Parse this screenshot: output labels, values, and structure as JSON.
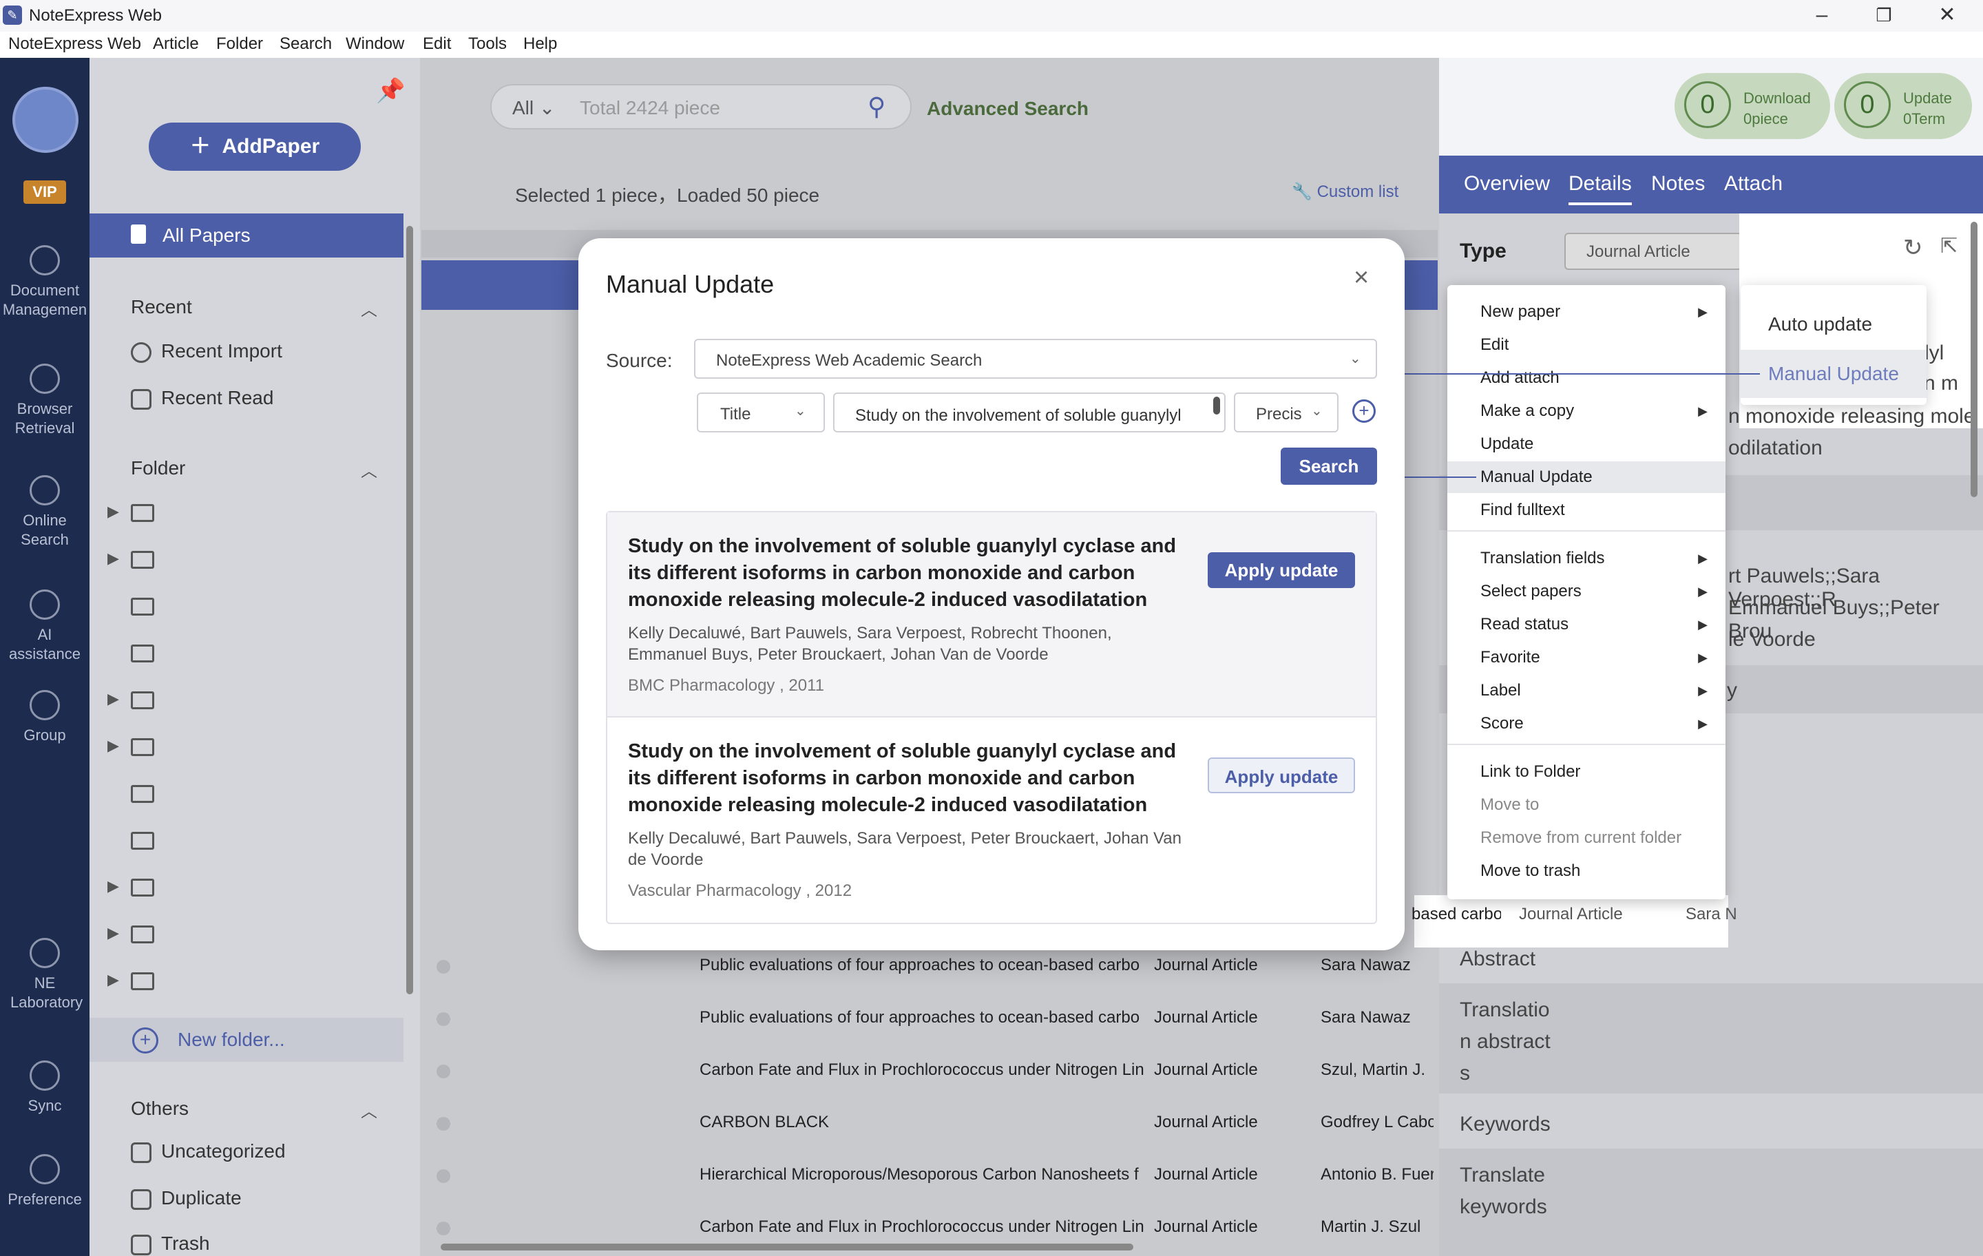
{
  "app": {
    "title": "NoteExpress Web"
  },
  "menubar": [
    "NoteExpress Web",
    "Article",
    "Folder",
    "Search",
    "Window",
    "Edit",
    "Tools",
    "Help"
  ],
  "rail": {
    "vip": "VIP",
    "items": [
      "Document Managemen",
      "Browser Retrieval",
      "Online Search",
      "AI assistance",
      "Group",
      "NE Laboratory",
      "Sync",
      "Preference"
    ]
  },
  "sidebar": {
    "add_paper": "AddPaper",
    "all_papers": "All Papers",
    "recent_head": "Recent",
    "recent_import": "Recent Import",
    "recent_read": "Recent Read",
    "folder_head": "Folder",
    "new_folder": "New folder...",
    "others_head": "Others",
    "uncategorized": "Uncategorized",
    "duplicate": "Duplicate",
    "trash": "Trash"
  },
  "search": {
    "scope": "All",
    "placeholder": "Total 2424 piece",
    "advanced": "Advanced Search"
  },
  "list": {
    "selection_info": "Selected 1 piece，Loaded 50 piece",
    "custom_list": "Custom list",
    "rows": [
      {
        "title": "Public evaluations of four approaches to ocean-based carbo",
        "type": "Journal Article",
        "author": "Sara Nawaz"
      },
      {
        "title": "Public evaluations of four approaches to ocean-based carbo",
        "type": "Journal Article",
        "author": "Sara Nawaz"
      },
      {
        "title": "Carbon Fate and Flux in Prochlorococcus under Nitrogen Lin",
        "type": "Journal Article",
        "author": "Szul, Martin J."
      },
      {
        "title": "CARBON BLACK",
        "type": "Journal Article",
        "author": "Godfrey L Cabc"
      },
      {
        "title": "Hierarchical Microporous/Mesoporous Carbon Nanosheets f",
        "type": "Journal Article",
        "author": "Antonio B. Fuer"
      },
      {
        "title": "Carbon Fate and Flux in Prochlorococcus under Nitrogen Lin",
        "type": "Journal Article",
        "author": "Martin J. Szul"
      }
    ]
  },
  "status": {
    "download_count": "0",
    "download_label": "Download",
    "download_sub": "0piece",
    "update_count": "0",
    "update_label": "Update",
    "update_sub": "0Term"
  },
  "right_panel": {
    "tabs": [
      "Overview",
      "Details",
      "Notes",
      "Attach"
    ],
    "type_label": "Type",
    "type_value": "Journal Article",
    "snippets": {
      "l1": "ylyl",
      "l2": "n m",
      "l3": "n monoxide releasing mole",
      "l4": "odilatation",
      "a1": "rt Pauwels;;Sara Verpoest;;R",
      "a2": "Emmanuel Buys;;Peter Brou",
      "a3": "le Voorde",
      "y": "y"
    },
    "abstract": "Abstract",
    "trans_abstract_1": "Translatio",
    "trans_abstract_2": "n abstract",
    "trans_abstract_3": "s",
    "keywords": "Keywords",
    "trans_keywords_1": "Translate",
    "trans_keywords_2": "keywords",
    "row_under_menu": {
      "title": "based carbo",
      "type": "Journal Article",
      "author": "Sara N"
    }
  },
  "context_menu": {
    "items": [
      {
        "label": "New paper",
        "sub": true
      },
      {
        "label": "Edit"
      },
      {
        "label": "Add attach"
      },
      {
        "label": "Make a copy",
        "sub": true
      },
      {
        "label": "Update"
      },
      {
        "label": "Manual Update",
        "highlight": true
      },
      {
        "label": "Find fulltext"
      },
      {
        "label": "Translation fields",
        "sub": true
      },
      {
        "label": "Select papers",
        "sub": true
      },
      {
        "label": "Read status",
        "sub": true
      },
      {
        "label": "Favorite",
        "sub": true
      },
      {
        "label": "Label",
        "sub": true
      },
      {
        "label": "Score",
        "sub": true
      },
      {
        "label": "Link to Folder"
      },
      {
        "label": "Move to",
        "disabled": true
      },
      {
        "label": "Remove from current folder",
        "disabled": true
      },
      {
        "label": "Move to trash"
      }
    ]
  },
  "submenu": {
    "auto_update": "Auto update",
    "manual_update": "Manual Update"
  },
  "modal": {
    "title": "Manual Update",
    "source_label": "Source:",
    "source_value": "NoteExpress Web Academic Search",
    "field": "Title",
    "query": "Study on the involvement of soluble guanylyl",
    "mode": "Precis",
    "search_button": "Search",
    "results": [
      {
        "title": "Study on the involvement of soluble guanylyl cyclase and its different isoforms in carbon monoxide and carbon monoxide releasing molecule-2 induced vasodilatation",
        "authors": "Kelly Decaluwé, Bart Pauwels, Sara Verpoest, Robrecht Thoonen, Emmanuel Buys, Peter Brouckaert, Johan Van de Voorde",
        "source": "BMC Pharmacology , 2011",
        "button": "Apply update"
      },
      {
        "title": "Study on the involvement of soluble guanylyl cyclase and its different isoforms in carbon monoxide and carbon monoxide releasing molecule-2 induced vasodilatation",
        "authors": "Kelly Decaluwé, Bart Pauwels, Sara Verpoest, Peter Brouckaert, Johan Van de Voorde",
        "source": "Vascular Pharmacology , 2012",
        "button": "Apply update"
      }
    ]
  },
  "colors": {
    "brand": "#4c5ea8",
    "rail": "#1d2b4e",
    "accent_green": "#4a6a3c"
  }
}
